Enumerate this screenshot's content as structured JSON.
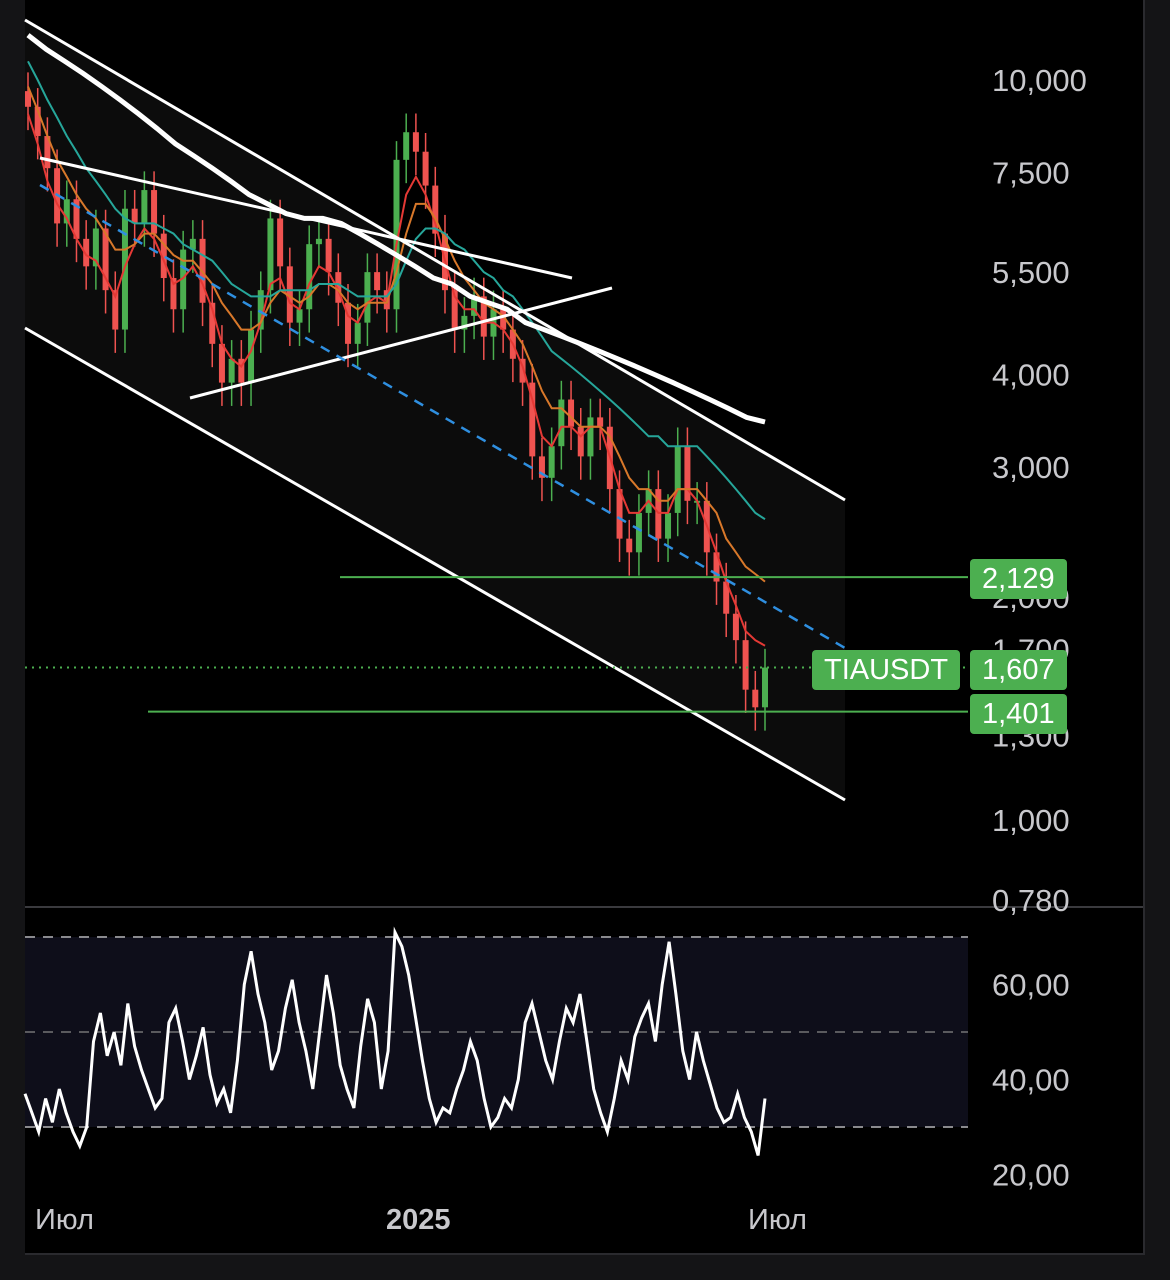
{
  "chart_data": [
    {
      "type": "candlestick",
      "symbol": "TIAUSDT",
      "scale": "log",
      "y_ticks": [
        "10,000",
        "7,500",
        "5,500",
        "4,000",
        "3,000",
        "2,000",
        "1,700",
        "1,300",
        "1,000",
        "0,780"
      ],
      "y_tick_values": [
        10.0,
        7.5,
        5.5,
        4.0,
        3.0,
        2.0,
        1.7,
        1.3,
        1.0,
        0.78
      ],
      "x_ticks": [
        "Июл",
        "2025",
        "Июл"
      ],
      "price_labels": [
        {
          "label": "2,129",
          "value": 2.129
        },
        {
          "label": "1,607",
          "value": 1.607,
          "symbol": "TIAUSDT"
        },
        {
          "label": "1,401",
          "value": 1.401
        }
      ],
      "horizontal_levels": [
        2.129,
        1.401
      ],
      "current_price": 1.607,
      "close_series": [
        9.2,
        8.4,
        7.6,
        6.4,
        6.9,
        6.1,
        5.6,
        6.3,
        5.2,
        4.6,
        6.7,
        6.4,
        7.1,
        6.2,
        5.4,
        4.9,
        5.9,
        6.1,
        5.0,
        4.4,
        3.9,
        4.2,
        3.9,
        4.6,
        5.2,
        6.5,
        5.6,
        4.7,
        4.9,
        6.0,
        6.1,
        5.5,
        5.0,
        4.4,
        4.7,
        5.5,
        5.2,
        4.9,
        7.8,
        8.5,
        8.0,
        7.2,
        6.2,
        5.2,
        4.6,
        4.8,
        5.1,
        4.5,
        4.9,
        4.6,
        4.2,
        3.9,
        3.1,
        2.9,
        3.2,
        3.7,
        3.4,
        3.1,
        3.5,
        3.4,
        2.8,
        2.4,
        2.3,
        2.6,
        2.8,
        2.4,
        2.6,
        3.2,
        2.7,
        2.7,
        2.3,
        2.1,
        1.9,
        1.75,
        1.5,
        1.42,
        1.607
      ],
      "moving_averages": [
        {
          "color": "#e53935",
          "values": [
            9.0,
            8.2,
            7.3,
            6.8,
            6.5,
            6.1,
            5.8,
            5.7,
            5.4,
            5.1,
            5.6,
            6.0,
            6.3,
            6.1,
            5.7,
            5.3,
            5.4,
            5.6,
            5.3,
            4.9,
            4.4,
            4.2,
            4.1,
            4.3,
            4.7,
            5.3,
            5.4,
            5.0,
            4.9,
            5.3,
            5.6,
            5.5,
            5.2,
            4.8,
            4.7,
            5.0,
            5.1,
            5.0,
            6.0,
            7.0,
            7.4,
            7.0,
            6.4,
            5.7,
            5.1,
            4.9,
            4.9,
            4.7,
            4.7,
            4.6,
            4.4,
            4.1,
            3.7,
            3.3,
            3.2,
            3.4,
            3.4,
            3.3,
            3.4,
            3.4,
            3.1,
            2.8,
            2.6,
            2.6,
            2.7,
            2.6,
            2.6,
            2.8,
            2.8,
            2.7,
            2.5,
            2.3,
            2.1,
            1.95,
            1.8,
            1.75,
            1.72
          ]
        },
        {
          "color": "#d8782a",
          "values": [
            9.8,
            9.1,
            8.4,
            7.8,
            7.4,
            7.0,
            6.7,
            6.5,
            6.2,
            5.9,
            5.9,
            6.0,
            6.2,
            6.2,
            6.0,
            5.8,
            5.7,
            5.7,
            5.5,
            5.3,
            5.0,
            4.8,
            4.6,
            4.6,
            4.7,
            5.0,
            5.2,
            5.1,
            5.0,
            5.1,
            5.3,
            5.3,
            5.2,
            5.0,
            4.9,
            5.0,
            5.0,
            5.0,
            5.5,
            6.2,
            6.8,
            6.8,
            6.5,
            6.1,
            5.7,
            5.4,
            5.2,
            5.0,
            4.9,
            4.8,
            4.6,
            4.4,
            4.1,
            3.8,
            3.6,
            3.6,
            3.5,
            3.4,
            3.4,
            3.4,
            3.3,
            3.1,
            2.9,
            2.8,
            2.8,
            2.7,
            2.7,
            2.8,
            2.8,
            2.8,
            2.7,
            2.6,
            2.4,
            2.3,
            2.2,
            2.15,
            2.1
          ]
        },
        {
          "color": "#26a69a",
          "values": [
            10.6,
            10.0,
            9.4,
            8.9,
            8.4,
            8.0,
            7.6,
            7.3,
            7.0,
            6.7,
            6.5,
            6.4,
            6.4,
            6.4,
            6.3,
            6.2,
            6.0,
            5.9,
            5.8,
            5.7,
            5.5,
            5.3,
            5.2,
            5.1,
            5.1,
            5.1,
            5.2,
            5.2,
            5.2,
            5.2,
            5.3,
            5.3,
            5.3,
            5.2,
            5.1,
            5.1,
            5.1,
            5.1,
            5.3,
            5.7,
            6.1,
            6.3,
            6.3,
            6.2,
            6.0,
            5.9,
            5.7,
            5.5,
            5.4,
            5.2,
            5.1,
            4.9,
            4.7,
            4.5,
            4.3,
            4.2,
            4.1,
            4.0,
            3.9,
            3.8,
            3.7,
            3.6,
            3.5,
            3.4,
            3.3,
            3.3,
            3.2,
            3.2,
            3.2,
            3.2,
            3.1,
            3.0,
            2.9,
            2.8,
            2.7,
            2.6,
            2.55
          ]
        },
        {
          "color": "#ffffff",
          "values": [
            11.5,
            11.0,
            10.6,
            10.2,
            9.8,
            9.4,
            9.0,
            8.6,
            8.2,
            7.9,
            7.6,
            7.3,
            7.0,
            6.8,
            6.6,
            6.5,
            6.5,
            6.4,
            6.2,
            6.0,
            5.8,
            5.6,
            5.4,
            5.3,
            5.1,
            5.0,
            4.9,
            4.7,
            4.6,
            4.5,
            4.4,
            4.3,
            4.2,
            4.1,
            4.0,
            3.9,
            3.8,
            3.7,
            3.6,
            3.5,
            3.45
          ]
        }
      ]
    },
    {
      "type": "line",
      "indicator": "RSI",
      "y_ticks": [
        "60,00",
        "40,00",
        "20,00"
      ],
      "y_tick_values": [
        60,
        40,
        20
      ],
      "band_levels": [
        70,
        50,
        30
      ],
      "values": [
        37,
        33,
        29,
        36,
        31,
        38,
        33,
        29,
        26,
        30,
        48,
        54,
        45,
        50,
        43,
        56,
        47,
        42,
        38,
        34,
        36,
        52,
        55,
        48,
        40,
        45,
        51,
        41,
        35,
        38,
        33,
        44,
        60,
        67,
        58,
        52,
        42,
        46,
        55,
        61,
        52,
        46,
        38,
        50,
        62,
        54,
        43,
        38,
        34,
        47,
        57,
        52,
        38,
        46,
        71,
        68,
        62,
        53,
        44,
        36,
        31,
        34,
        33,
        38,
        42,
        48,
        44,
        36,
        30,
        32,
        36,
        34,
        40,
        52,
        56,
        50,
        44,
        40,
        48,
        55,
        52,
        58,
        48,
        38,
        33,
        29,
        36,
        44,
        40,
        49,
        53,
        56,
        48,
        60,
        69,
        58,
        46,
        40,
        50,
        44,
        39,
        34,
        31,
        32,
        37,
        32,
        29,
        24,
        36
      ]
    }
  ]
}
